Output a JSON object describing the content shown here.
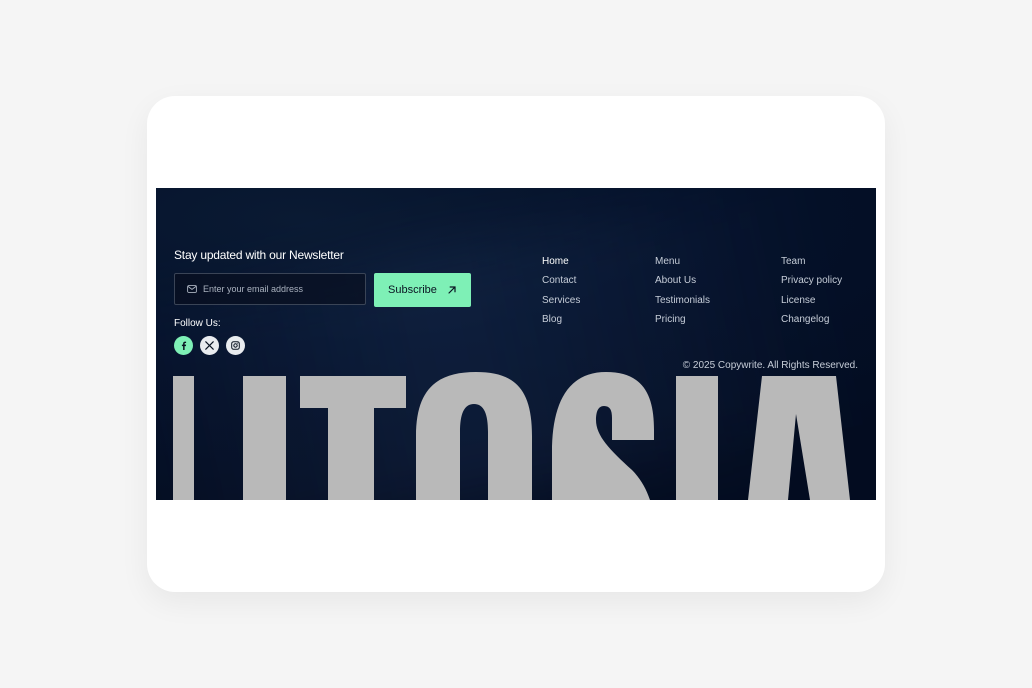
{
  "newsletter": {
    "title": "Stay updated with our Newsletter",
    "email_placeholder": "Enter your email address",
    "subscribe_label": "Subscribe"
  },
  "follow": {
    "label": "Follow Us:",
    "icons": [
      "facebook-icon",
      "x-icon",
      "instagram-icon"
    ]
  },
  "nav": {
    "col1": [
      "Home",
      "Contact",
      "Services",
      "Blog"
    ],
    "col2": [
      "Menu",
      "About Us",
      "Testimonials",
      "Pricing"
    ],
    "col3": [
      "Team",
      "Privacy policy",
      "License",
      "Changelog"
    ]
  },
  "copyright": "© 2025 Copywrite. All Rights Reserved.",
  "brand": {
    "wordmark": "UTOSIA"
  },
  "colors": {
    "background": "#f5f5f5",
    "card": "#ffffff",
    "footer": "#04112a",
    "accent": "#7ef0b6",
    "wordmark": "#b9b9b9"
  }
}
